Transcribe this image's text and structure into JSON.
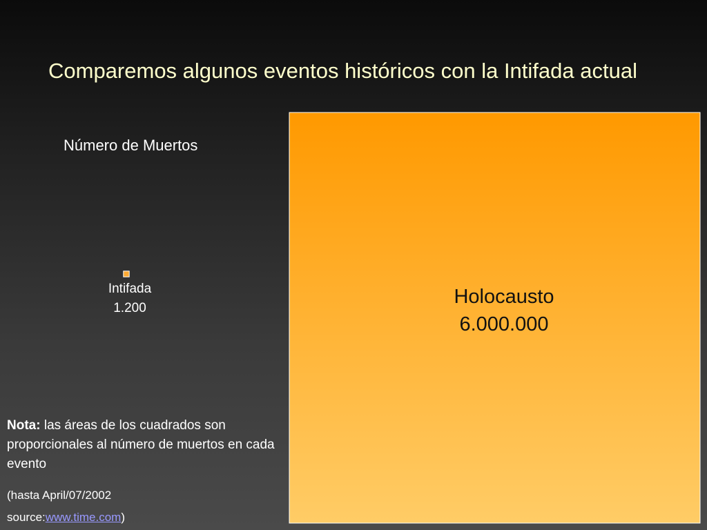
{
  "slide": {
    "title": "Comparemos algunos eventos históricos con la Intifada actual",
    "note_bold": "Nota:",
    "note_text": " las áreas de los cuadrados son proporcionales al número de muertos en cada evento",
    "date_text": "(hasta April/07/2002",
    "source_prefix": "source:",
    "source_link": "www.time.com",
    "source_suffix": ")"
  },
  "chart_data": {
    "type": "area-squares",
    "title": "Número de Muertos",
    "series": [
      {
        "name": "Intifada",
        "value": 1200,
        "value_label": "1.200",
        "color": "#ffaa33"
      },
      {
        "name": "Holocausto",
        "value": 6000000,
        "value_label": "6.000.000",
        "color": "#ff9900"
      }
    ],
    "colors": {
      "big_top": "#ff9900",
      "big_bottom": "#ffcc66",
      "small_fill": "#ffaa33",
      "border": "#ffffff"
    }
  }
}
